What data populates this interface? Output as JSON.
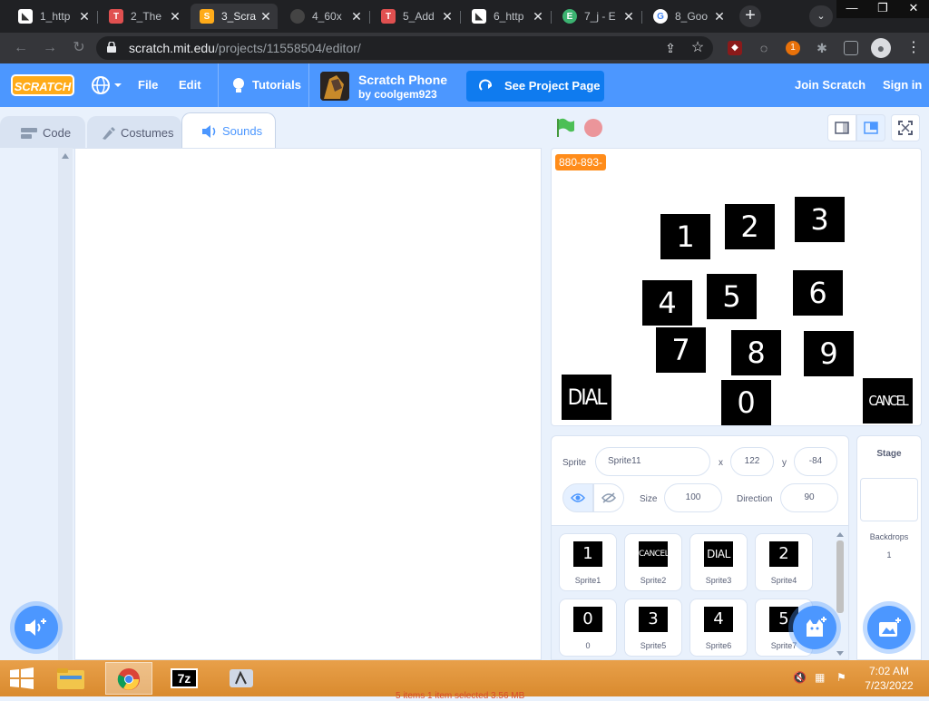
{
  "browser": {
    "tabs": [
      {
        "title": "1_http",
        "active": false
      },
      {
        "title": "2_The",
        "active": false
      },
      {
        "title": "3_Scra",
        "active": true
      },
      {
        "title": "4_60x",
        "active": false
      },
      {
        "title": "5_Add",
        "active": false
      },
      {
        "title": "6_http",
        "active": false
      },
      {
        "title": "7_j - E",
        "active": false
      },
      {
        "title": "8_Goo",
        "active": false
      }
    ],
    "url_host": "scratch.mit.edu",
    "url_path": "/projects/11558504/editor/",
    "extension_badge": "1"
  },
  "menubar": {
    "logo": "SCRATCH",
    "file": "File",
    "edit": "Edit",
    "tutorials": "Tutorials",
    "project_title": "Scratch Phone",
    "project_author": "by coolgem923",
    "see_project_page": "See Project Page",
    "join": "Join Scratch",
    "signin": "Sign in"
  },
  "editor_tabs": {
    "code": "Code",
    "costumes": "Costumes",
    "sounds": "Sounds"
  },
  "stage": {
    "variable_monitor": "880-893-",
    "keys": [
      "1",
      "2",
      "3",
      "4",
      "5",
      "6",
      "7",
      "8",
      "9",
      "0"
    ],
    "dial": "DIAL",
    "cancel": "CANCEL"
  },
  "sprite_info": {
    "sprite_label": "Sprite",
    "sprite_name": "Sprite11",
    "x_label": "x",
    "x_value": "122",
    "y_label": "y",
    "y_value": "-84",
    "size_label": "Size",
    "size_value": "100",
    "direction_label": "Direction",
    "direction_value": "90"
  },
  "sprites": [
    {
      "costume": "1",
      "name": "Sprite1"
    },
    {
      "costume": "CANCEL",
      "name": "Sprite2"
    },
    {
      "costume": "DIAL",
      "name": "Sprite3"
    },
    {
      "costume": "2",
      "name": "Sprite4"
    },
    {
      "costume": "0",
      "name": "0"
    },
    {
      "costume": "3",
      "name": "Sprite5"
    },
    {
      "costume": "4",
      "name": "Sprite6"
    },
    {
      "costume": "5",
      "name": "Sprite7"
    }
  ],
  "stage_pane": {
    "title": "Stage",
    "backdrops_label": "Backdrops",
    "backdrops_count": "1"
  },
  "taskbar": {
    "time": "7:02 AM",
    "date": "7/23/2022",
    "sevenzip": "7z",
    "status_text": "5 items    1 item selected  3.56 MB"
  }
}
